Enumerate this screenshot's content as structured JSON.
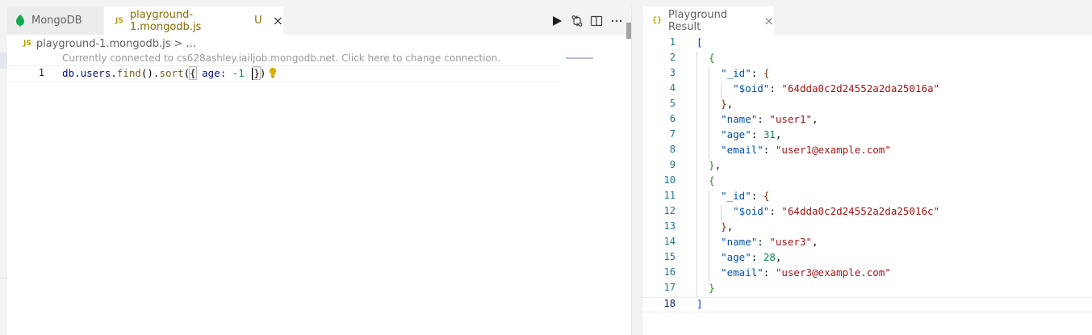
{
  "colors": {
    "accent": "#8b6c00",
    "js_badge": "#b3a100",
    "leaf": "#13aa52"
  },
  "left_tabs": [
    {
      "label": "MongoDB",
      "icon": "mongodb-leaf-icon"
    },
    {
      "badge": "JS",
      "label": "playground-1.mongodb.js",
      "status": "U",
      "close": "×"
    }
  ],
  "tab_actions": [
    "run-icon",
    "git-compare-icon",
    "split-editor-icon",
    "more-icon"
  ],
  "breadcrumb": {
    "badge": "JS",
    "file": "playground-1.mongodb.js",
    "separator": ">",
    "rest": "..."
  },
  "editor": {
    "codelens": "Currently connected to cs628ashley.iailjob.mongodb.net. Click here to change connection.",
    "line_number": "1",
    "code": {
      "p1": "db",
      "p2": ".",
      "p3": "users",
      "p4": ".",
      "p5": "find",
      "p6": "().",
      "p7": "sort",
      "p8": "(",
      "p9": "{",
      "p10": " age: ",
      "p11": "-1",
      "p12": " ",
      "p13": "}",
      "p14": ")"
    }
  },
  "result_tab": {
    "icon": "{}",
    "label": "Playground Result",
    "close": "×"
  },
  "result_lines": [
    {
      "n": "1",
      "t": "["
    },
    {
      "n": "2",
      "t": "  {"
    },
    {
      "n": "3",
      "t": "    \"_id\": {"
    },
    {
      "n": "4",
      "t": "      \"$oid\": \"64dda0c2d24552a2da25016a\""
    },
    {
      "n": "5",
      "t": "    },"
    },
    {
      "n": "6",
      "t": "    \"name\": \"user1\","
    },
    {
      "n": "7",
      "t": "    \"age\": 31,"
    },
    {
      "n": "8",
      "t": "    \"email\": \"user1@example.com\""
    },
    {
      "n": "9",
      "t": "  },"
    },
    {
      "n": "10",
      "t": "  {"
    },
    {
      "n": "11",
      "t": "    \"_id\": {"
    },
    {
      "n": "12",
      "t": "      \"$oid\": \"64dda0c2d24552a2da25016c\""
    },
    {
      "n": "13",
      "t": "    },"
    },
    {
      "n": "14",
      "t": "    \"name\": \"user3\","
    },
    {
      "n": "15",
      "t": "    \"age\": 28,"
    },
    {
      "n": "16",
      "t": "    \"email\": \"user3@example.com\""
    },
    {
      "n": "17",
      "t": "  }"
    },
    {
      "n": "18",
      "t": "]"
    }
  ]
}
